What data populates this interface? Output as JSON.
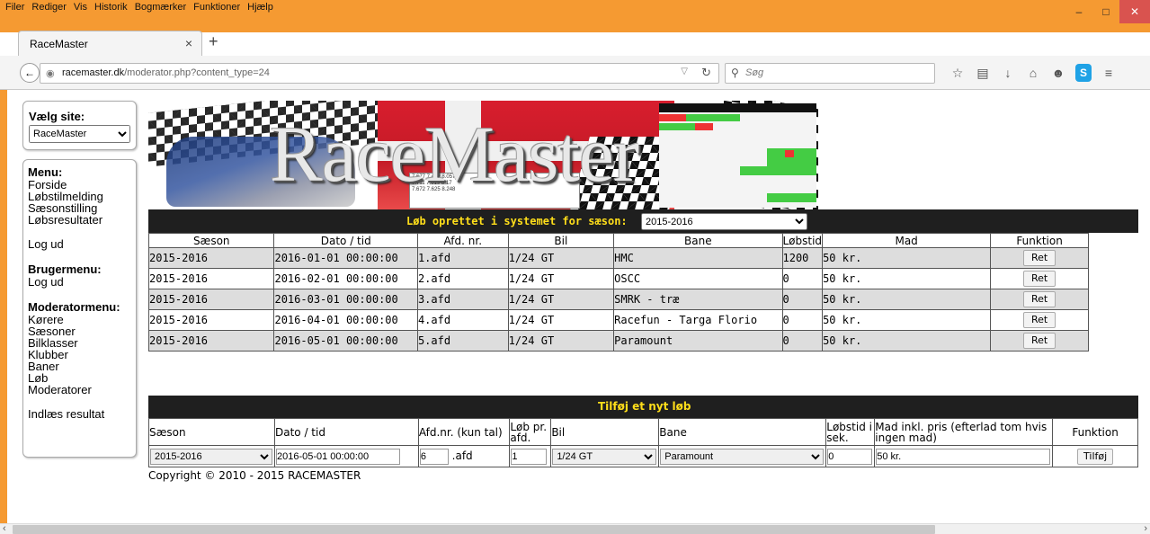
{
  "browser": {
    "menus": [
      "Filer",
      "Rediger",
      "Vis",
      "Historik",
      "Bogmærker",
      "Funktioner",
      "Hjælp"
    ],
    "tab_title": "RaceMaster",
    "url_domain": "racemaster.dk",
    "url_path": "/moderator.php?content_type=24",
    "search_placeholder": "Søg"
  },
  "sidebar": {
    "site_title": "Vælg site:",
    "site_selected": "RaceMaster",
    "menu_heading": "Menu:",
    "menu_items": [
      "Forside",
      "Løbstilmelding",
      "Sæsonstilling",
      "Løbsresultater"
    ],
    "logout1": "Log ud",
    "user_heading": "Brugermenu:",
    "logout2": "Log ud",
    "mod_heading": "Moderatormenu:",
    "mod_items": [
      "Kørere",
      "Sæsoner",
      "Bilklasser",
      "Klubber",
      "Baner",
      "Løb",
      "Moderatorer"
    ],
    "import": "Indlæs resultat"
  },
  "banner": {
    "logo": "RaceMaster"
  },
  "races": {
    "bar_label": "Løb oprettet i systemet for sæson:",
    "season_selected": "2015-2016",
    "headers": [
      "Sæson",
      "Dato / tid",
      "Afd. nr.",
      "Bil",
      "Bane",
      "Løbstid",
      "Mad",
      "Funktion"
    ],
    "rows": [
      {
        "season": "2015-2016",
        "date": "2016-01-01 00:00:00",
        "afd": "1.afd",
        "bil": "1/24 GT",
        "bane": "HMC",
        "tid": "1200",
        "mad": "50 kr.",
        "fn": "Ret"
      },
      {
        "season": "2015-2016",
        "date": "2016-02-01 00:00:00",
        "afd": "2.afd",
        "bil": "1/24 GT",
        "bane": "OSCC",
        "tid": "0",
        "mad": "50 kr.",
        "fn": "Ret"
      },
      {
        "season": "2015-2016",
        "date": "2016-03-01 00:00:00",
        "afd": "3.afd",
        "bil": "1/24 GT",
        "bane": "SMRK - træ",
        "tid": "0",
        "mad": "50 kr.",
        "fn": "Ret"
      },
      {
        "season": "2015-2016",
        "date": "2016-04-01 00:00:00",
        "afd": "4.afd",
        "bil": "1/24 GT",
        "bane": "Racefun - Targa Florio",
        "tid": "0",
        "mad": "50 kr.",
        "fn": "Ret"
      },
      {
        "season": "2015-2016",
        "date": "2016-05-01 00:00:00",
        "afd": "5.afd",
        "bil": "1/24 GT",
        "bane": "Paramount",
        "tid": "0",
        "mad": "50 kr.",
        "fn": "Ret"
      }
    ]
  },
  "add": {
    "bar_label": "Tilføj et nyt løb",
    "h_season": "Sæson",
    "h_date": "Dato / tid",
    "h_afd": "Afd.nr. (kun tal)",
    "h_lob": "Løb pr. afd.",
    "h_bil": "Bil",
    "h_bane": "Bane",
    "h_tid": "Løbstid i sek.",
    "h_mad": "Mad inkl. pris (efterlad tom hvis ingen mad)",
    "h_fn": "Funktion",
    "season": "2015-2016",
    "date": "2016-05-01 00:00:00",
    "afd": "6",
    "afd_suffix": ".afd",
    "lob": "1",
    "bil": "1/24 GT",
    "bane": "Paramount",
    "tid": "0",
    "mad": "50 kr.",
    "btn": "Tilføj"
  },
  "footer": {
    "copyright": "Copyright © 2010 - 2015 RACEMASTER"
  }
}
